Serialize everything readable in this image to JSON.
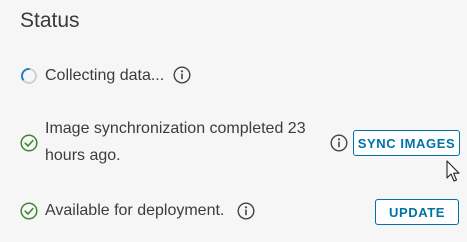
{
  "panel": {
    "title": "Status"
  },
  "rows": [
    {
      "status": "loading",
      "icon": "spinner-icon",
      "text": "Collecting data..."
    },
    {
      "status": "success",
      "icon": "check-circle-icon",
      "text_line1": "Image synchronization completed 23",
      "text_line2": "hours ago.",
      "button_label": "SYNC IMAGES"
    },
    {
      "status": "success",
      "icon": "check-circle-icon",
      "text": "Available for deployment.",
      "button_label": "UPDATE"
    }
  ],
  "icons": {
    "info": "info-circle-icon",
    "cursor": "mouse-pointer-icon"
  },
  "colors": {
    "accent": "#0072a3",
    "success": "#3c8a2e",
    "spinner": "#2a7fc0"
  }
}
